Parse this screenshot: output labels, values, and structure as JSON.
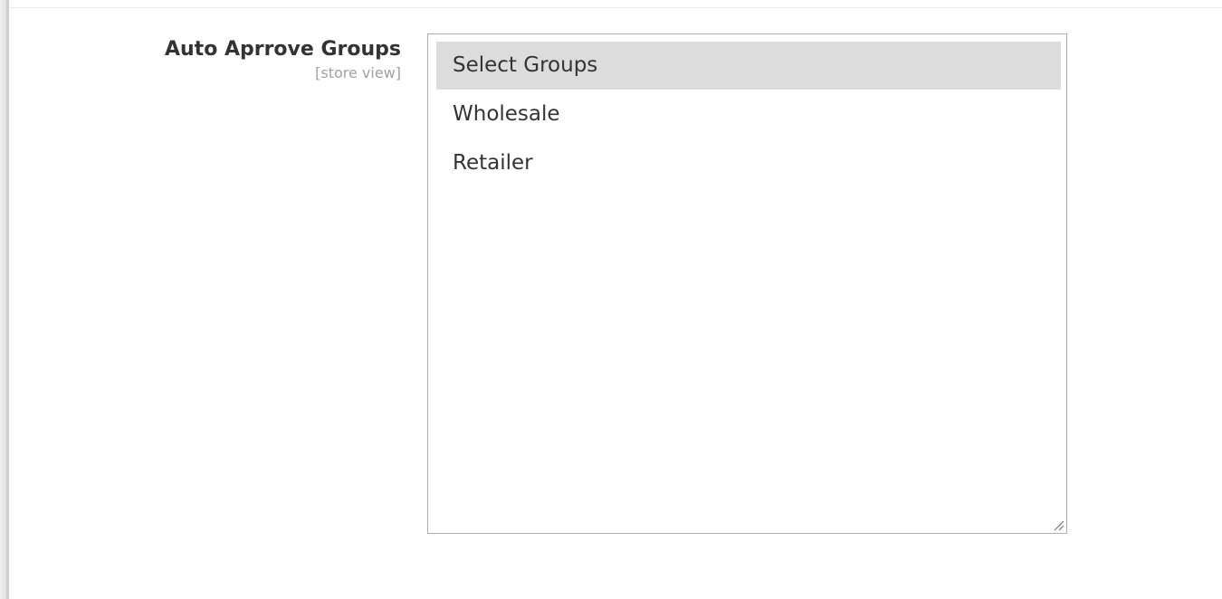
{
  "field": {
    "label": "Auto Aprrove Groups",
    "scope": "[store view]"
  },
  "groups_select": {
    "options": [
      {
        "label": "Select Groups",
        "selected": true
      },
      {
        "label": "Wholesale",
        "selected": false
      },
      {
        "label": "Retailer",
        "selected": false
      }
    ]
  },
  "colors": {
    "selected_option_bg": "#dcdcdc",
    "border": "#adadad",
    "label_text": "#333333",
    "scope_text": "#a0a0a0"
  },
  "icons": {
    "resize": "resize-grip-icon"
  }
}
